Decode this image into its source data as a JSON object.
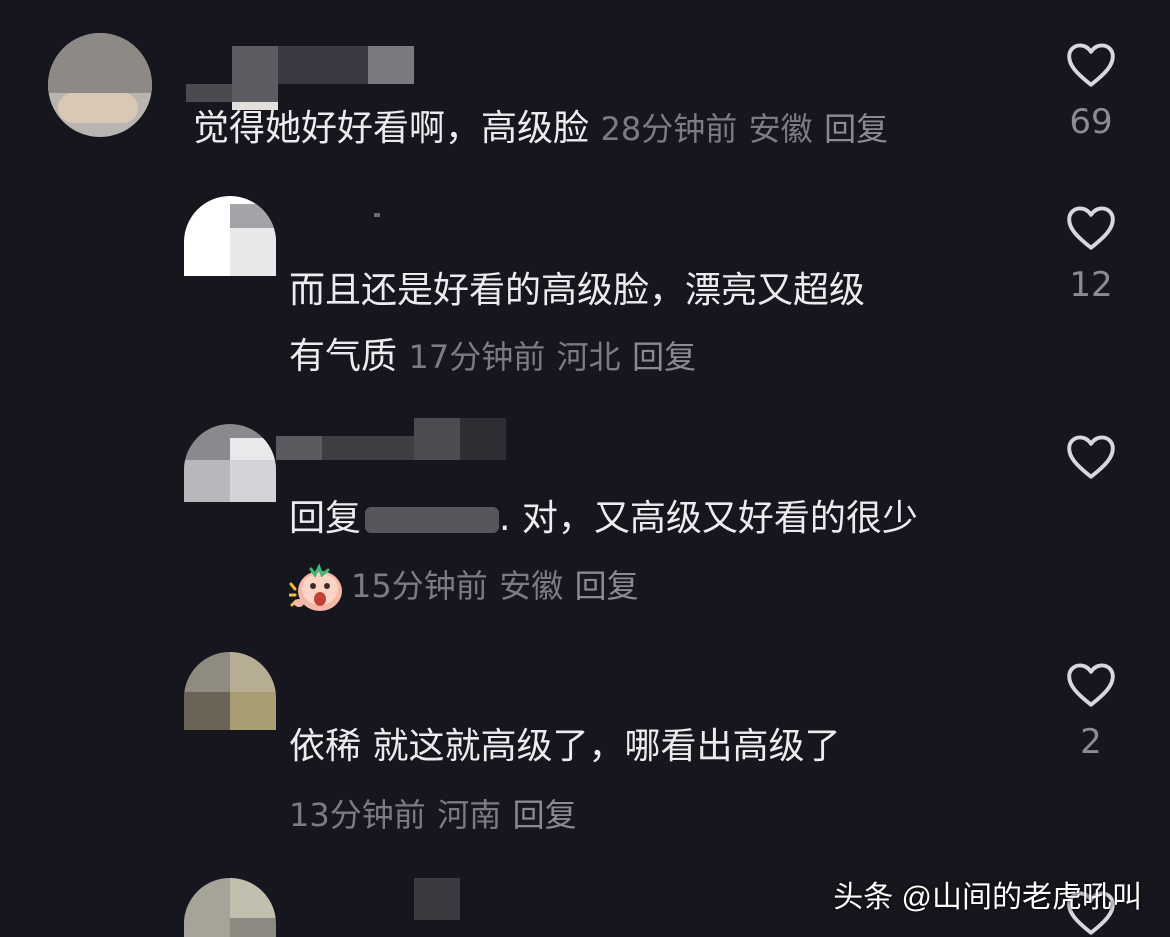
{
  "comments": [
    {
      "text": "觉得她好好看啊，高级脸",
      "time": "28分钟前",
      "location": "安徽",
      "reply_label": "回复",
      "likes": "69"
    },
    {
      "text_line1": "而且还是好看的高级脸，漂亮又超级",
      "text_line2": "有气质",
      "time": "17分钟前",
      "location": "河北",
      "reply_label": "回复",
      "likes": "12"
    },
    {
      "reply_prefix": "回复",
      "text": ". 对，又高级又好看的很少",
      "time": "15分钟前",
      "location": "安徽",
      "reply_label": "回复",
      "likes": ""
    },
    {
      "text": "依稀  就这就高级了，哪看出高级了",
      "time": "13分钟前",
      "location": "河南",
      "reply_label": "回复",
      "likes": "2"
    }
  ],
  "watermark": "头条 @山间的老虎吼叫",
  "icons": {
    "like": "heart-outline-icon",
    "emoji": "shocked-face-emoji-icon"
  },
  "colors": {
    "background": "#16161e",
    "text": "#ececf0",
    "meta": "#7b7b86"
  }
}
